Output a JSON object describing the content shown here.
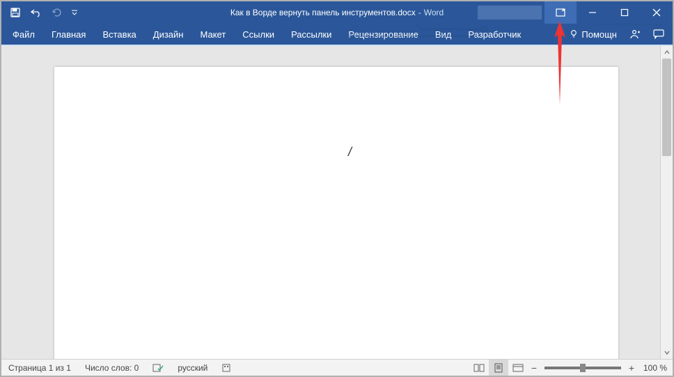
{
  "title": {
    "doc_name": "Как в Ворде вернуть панель инструментов.docx",
    "sep": "-",
    "app": "Word"
  },
  "tabs": {
    "file": "Файл",
    "home": "Главная",
    "insert": "Вставка",
    "design": "Дизайн",
    "layout": "Макет",
    "references": "Ссылки",
    "mailings": "Рассылки",
    "review": "Рецензирование",
    "view": "Вид",
    "developer": "Разработчик",
    "help_label": "Помощн"
  },
  "status": {
    "page": "Страница 1 из 1",
    "words": "Число слов: 0",
    "lang": "русский",
    "zoom_pct": "100 %",
    "zoom_minus": "−",
    "zoom_plus": "+"
  },
  "doc": {
    "cursor_glyph": "/"
  }
}
